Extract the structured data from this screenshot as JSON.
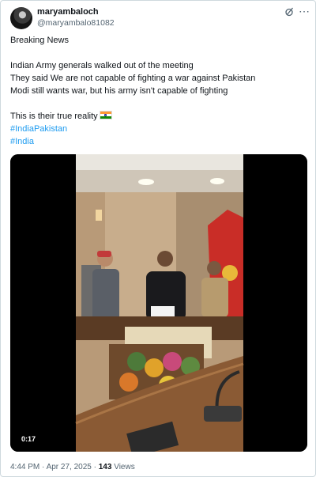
{
  "post": {
    "display_name": "maryambaloch",
    "handle": "@maryambalo81082",
    "text_lines": [
      "Breaking News",
      "Indian Army generals walked out of the meeting",
      "They said We are not capable of fighting a war against Pakistan",
      "Modi still wants war, but his army isn't capable of fighting",
      "This is their true reality"
    ],
    "hashtags": [
      "#IndiaPakistan",
      "#India"
    ],
    "flag_emoji": "indian-flag-icon",
    "video": {
      "duration": "0:17"
    },
    "time": "4:44 PM · Apr 27, 2025 · ",
    "views_count": "143",
    "views_label": " Views"
  },
  "icons": [
    "avatar",
    "grok-icon",
    "more-options-icon",
    "indian-flag-icon"
  ],
  "colors": {
    "link": "#1d9bf0",
    "secondary_text": "#536471",
    "text": "#0f1419",
    "border": "#cfd9de"
  }
}
